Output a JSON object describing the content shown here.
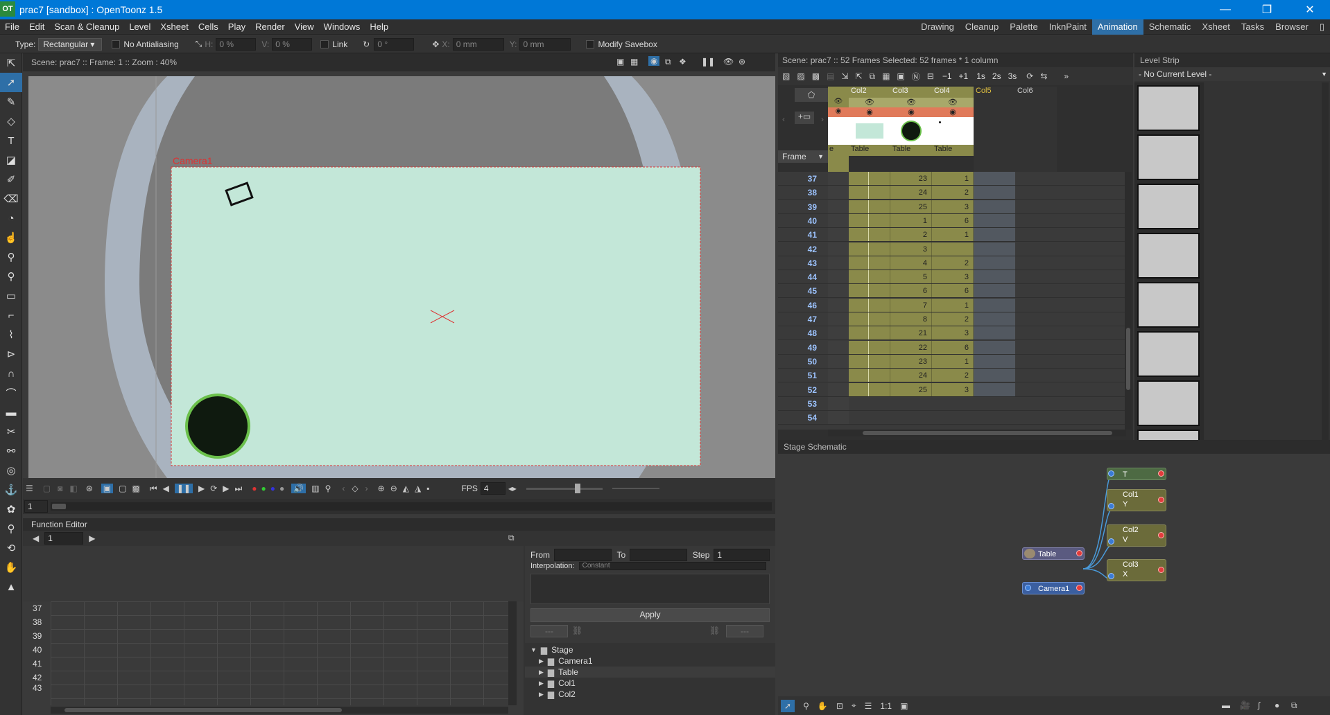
{
  "window": {
    "title": "prac7 [sandbox] : OpenToonz 1.5",
    "logo": "OT"
  },
  "menu": [
    "File",
    "Edit",
    "Scan & Cleanup",
    "Level",
    "Xsheet",
    "Cells",
    "Play",
    "Render",
    "View",
    "Windows",
    "Help"
  ],
  "rooms": [
    "Drawing",
    "Cleanup",
    "Palette",
    "InknPaint",
    "Animation",
    "Schematic",
    "Xsheet",
    "Tasks",
    "Browser"
  ],
  "active_room": "Animation",
  "tool_options": {
    "type_label": "Type:",
    "type_value": "Rectangular",
    "antialias": "No Antialiasing",
    "h_label": "H:",
    "h_value": "0 %",
    "v_label": "V:",
    "v_value": "0 %",
    "link": "Link",
    "rot_value": "0 °",
    "x_label": "X:",
    "x_value": "0 mm",
    "y_label": "Y:",
    "y_value": "0 mm",
    "modify_savebox": "Modify Savebox"
  },
  "viewer": {
    "header": "Scene: prac7  ::  Frame: 1  ::  Zoom : 40%",
    "camera_label": "Camera1",
    "fps_label": "FPS",
    "fps_value": "4",
    "frame_value": "1"
  },
  "function_editor": {
    "title": "Function Editor",
    "frame_value": "1",
    "rows": [
      "37",
      "38",
      "39",
      "40",
      "41",
      "42",
      "43"
    ],
    "from_label": "From",
    "to_label": "To",
    "step_label": "Step",
    "step_value": "1",
    "interp_label": "Interpolation:",
    "interp_value": "Constant",
    "apply": "Apply",
    "dash1": "---",
    "dash2": "---",
    "tree": [
      {
        "label": "Stage",
        "level": 0
      },
      {
        "label": "Camera1",
        "level": 1
      },
      {
        "label": "Table",
        "level": 1
      },
      {
        "label": "Col1",
        "level": 1
      },
      {
        "label": "Col2",
        "level": 1
      }
    ]
  },
  "xsheet": {
    "header": "Scene: prac7  ::  52 Frames  Selected: 52 frames * 1 column",
    "frame_label": "Frame",
    "columns": [
      "Col2",
      "Col3",
      "Col4",
      "Col5",
      "Col6"
    ],
    "pegbar_labels": [
      "Table",
      "Table",
      "Table",
      "Table"
    ],
    "rows": [
      {
        "f": "37",
        "c3": "23",
        "c4": "1"
      },
      {
        "f": "38",
        "c3": "24",
        "c4": "2"
      },
      {
        "f": "39",
        "c3": "25",
        "c4": "3"
      },
      {
        "f": "40",
        "c3": "1",
        "c4": "6"
      },
      {
        "f": "41",
        "c3": "2",
        "c4": "1"
      },
      {
        "f": "42",
        "c3": "3",
        "c4": ""
      },
      {
        "f": "43",
        "c3": "4",
        "c4": "2"
      },
      {
        "f": "44",
        "c3": "5",
        "c4": "3"
      },
      {
        "f": "45",
        "c3": "6",
        "c4": "6"
      },
      {
        "f": "46",
        "c3": "7",
        "c4": "1"
      },
      {
        "f": "47",
        "c3": "8",
        "c4": "2"
      },
      {
        "f": "48",
        "c3": "21",
        "c4": "3"
      },
      {
        "f": "49",
        "c3": "22",
        "c4": "6"
      },
      {
        "f": "50",
        "c3": "23",
        "c4": "1"
      },
      {
        "f": "51",
        "c3": "24",
        "c4": "2"
      },
      {
        "f": "52",
        "c3": "25",
        "c4": "3"
      },
      {
        "f": "53",
        "c3": "",
        "c4": ""
      },
      {
        "f": "54",
        "c3": "",
        "c4": ""
      }
    ],
    "toolbar_text": [
      "−1",
      "+1",
      "1s",
      "2s",
      "3s"
    ]
  },
  "level_strip": {
    "title": "Level Strip",
    "current": "- No Current Level -"
  },
  "schematic": {
    "title": "Stage Schematic",
    "nodes": {
      "t": "T",
      "col1": "Col1",
      "col1_sub": "Y",
      "col2": "Col2",
      "col2_sub": "V",
      "col3": "Col3",
      "col3_sub": "X",
      "table": "Table",
      "camera": "Camera1"
    },
    "zoom_label": "1:1"
  },
  "colors": {
    "accent": "#2e6fa7",
    "canvas_paper": "#c2e6d8",
    "xsheet_col": "#8a8a4a",
    "xsheet_col_light": "#a8a86a"
  }
}
